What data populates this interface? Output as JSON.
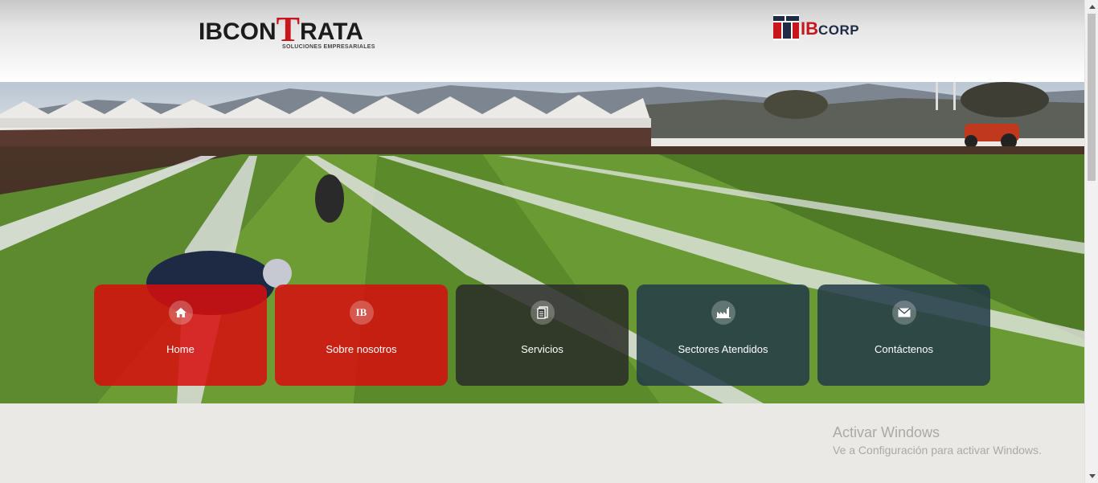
{
  "header": {
    "brand_prefix": "IBCON",
    "brand_t": "T",
    "brand_suffix": "RATA",
    "brand_tagline": "SOLUCIONES EMPRESARIALES",
    "partner_ib": "IB",
    "partner_corp": "CORP"
  },
  "nav": {
    "tiles": [
      {
        "label": "Home",
        "icon": "home-icon"
      },
      {
        "label": "Sobre nosotros",
        "icon": "ib-badge-icon",
        "icon_text": "IB"
      },
      {
        "label": "Servicios",
        "icon": "document-icon"
      },
      {
        "label": "Sectores Atendidos",
        "icon": "factory-icon"
      },
      {
        "label": "Contáctenos",
        "icon": "envelope-icon"
      }
    ]
  },
  "watermark": {
    "title": "Activar Windows",
    "subtitle": "Ve a Configuración para activar Windows."
  },
  "colors": {
    "brand_red": "#c8161d",
    "tile_red": "#d60e0e",
    "tile_dark": "#2a2c28",
    "tile_navy": "#233a48",
    "page_bg": "#ebe9e5"
  }
}
